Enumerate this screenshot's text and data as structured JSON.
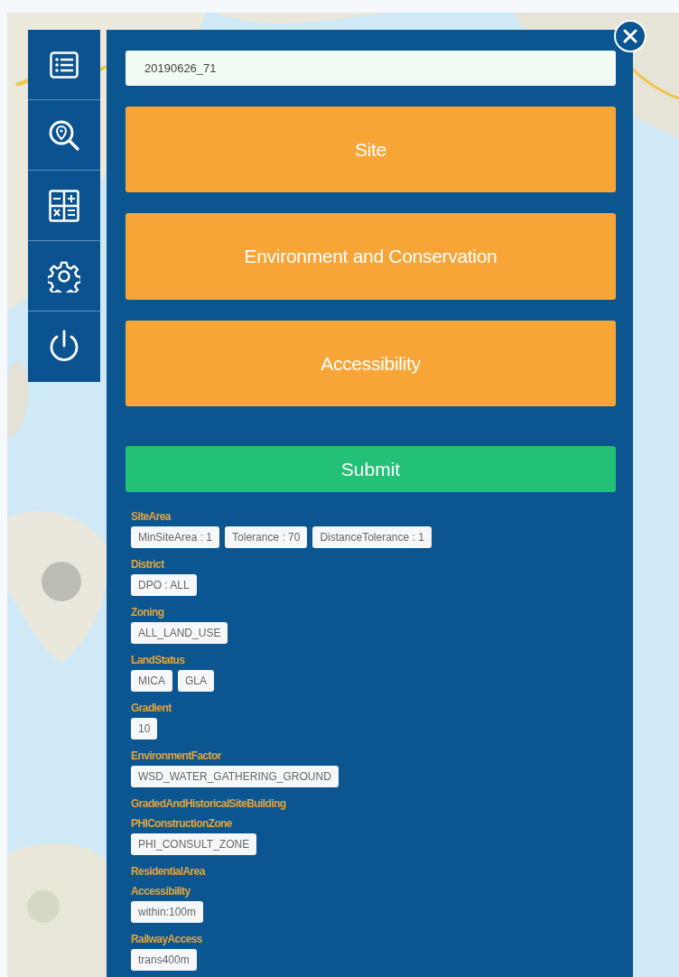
{
  "form": {
    "name_field": {
      "value": "20190626_71"
    },
    "sections": [
      {
        "label": "Site"
      },
      {
        "label": "Environment and Conservation"
      },
      {
        "label": "Accessibility"
      }
    ],
    "submit": "Submit"
  },
  "criteria": [
    {
      "label": "SiteArea",
      "tags": [
        "MinSiteArea : 1",
        "Tolerance : 70",
        "DistanceTolerance : 1"
      ]
    },
    {
      "label": "District",
      "tags": [
        "DPO : ALL"
      ]
    },
    {
      "label": "Zoning",
      "tags": [
        "ALL_LAND_USE"
      ]
    },
    {
      "label": "LandStatus",
      "tags": [
        "MICA",
        "GLA"
      ]
    },
    {
      "label": "Gradient",
      "tags": [
        "10"
      ]
    },
    {
      "label": "EnvironmentFactor",
      "tags": [
        "WSD_WATER_GATHERING_GROUND"
      ]
    },
    {
      "label": "GradedAndHistoricalSiteBuilding"
    },
    {
      "label": "PHIConstructionZone",
      "tags": [
        "PHI_CONSULT_ZONE"
      ]
    },
    {
      "label": "ResidentialArea"
    },
    {
      "label": "Accessibility",
      "tags": [
        "within:100m"
      ]
    },
    {
      "label": "RailwayAccess",
      "tags": [
        "trans400m"
      ]
    }
  ]
}
